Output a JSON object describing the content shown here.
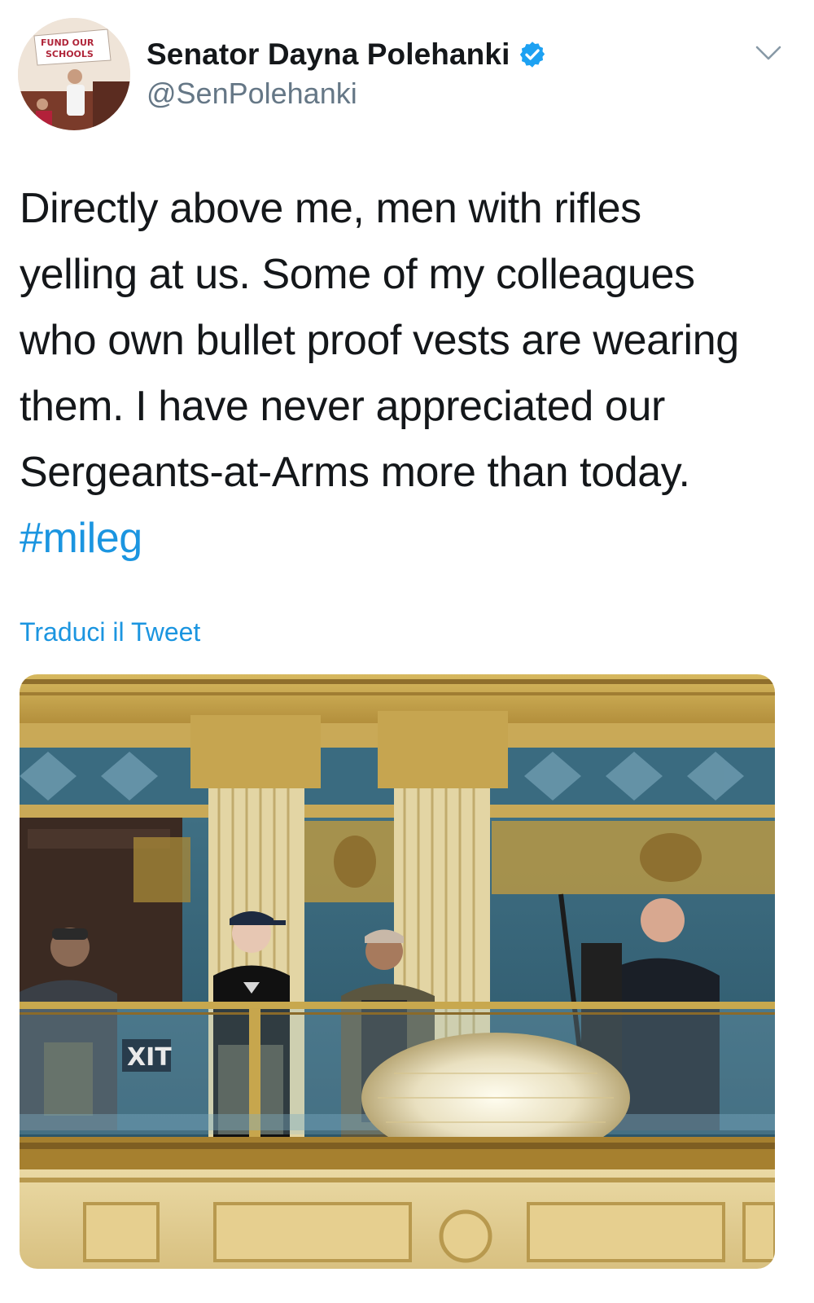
{
  "author": {
    "display_name": "Senator Dayna Polehanki",
    "handle": "@SenPolehanki",
    "avatar_sign_text": "FUND OUR SCHOOLS"
  },
  "tweet": {
    "text_main": "Directly above me, men with rifles yelling at us. Some of my colleagues who own bullet proof vests are wearing them. I have never appreciated our Sergeants-at-Arms more than today.",
    "hashtag": "#mileg",
    "translate_label": "Traduci il Tweet"
  },
  "media": {
    "exit_sign_text": "XIT"
  },
  "icons": {
    "verified": "verified-badge-icon",
    "menu": "chevron-down-icon"
  },
  "colors": {
    "link": "#1b95e0",
    "secondary_text": "#657786",
    "primary_text": "#14171a",
    "verified": "#1da1f2"
  }
}
